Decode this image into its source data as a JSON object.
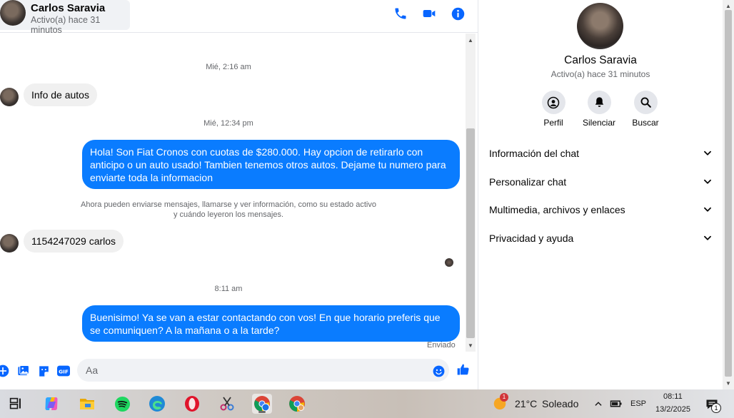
{
  "header": {
    "name": "Carlos Saravia",
    "status": "Activo(a) hace 31 minutos"
  },
  "messages": {
    "ts1": "Mié, 2:16 am",
    "msg1": "Info de autos",
    "ts2": "Mié, 12:34 pm",
    "msg2": "Hola! Son Fiat Cronos con cuotas de $280.000. Hay opcion de retirarlo con anticipo o un auto usado! Tambien tenemos otros autos. Dejame tu numero para enviarte toda la informacion",
    "notice_line1": "Ahora pueden enviarse mensajes, llamarse y ver información, como su estado activo",
    "notice_line2": "y cuándo leyeron los mensajes.",
    "msg3": "1154247029 carlos",
    "ts3": "8:11 am",
    "msg4": "Buenisimo! Ya se van a estar contactando con vos! En que horario preferis que se comuniquen? A la mañana o a la tarde?",
    "sent": "Enviado"
  },
  "composer": {
    "placeholder": "Aa",
    "value": ""
  },
  "info": {
    "name": "Carlos Saravia",
    "status": "Activo(a) hace 31 minutos",
    "actions": [
      "Perfil",
      "Silenciar",
      "Buscar"
    ],
    "sections": [
      "Información del chat",
      "Personalizar chat",
      "Multimedia, archivos y enlaces",
      "Privacidad y ayuda"
    ]
  },
  "taskbar": {
    "weather_temp": "21°C",
    "weather_text": "Soleado",
    "weather_badge": "1",
    "language": "ESP",
    "time": "08:11",
    "date": "13/2/2025",
    "notif_count": "1"
  },
  "colors": {
    "accent": "#0a7cff",
    "icon_blue": "#0866ff"
  }
}
